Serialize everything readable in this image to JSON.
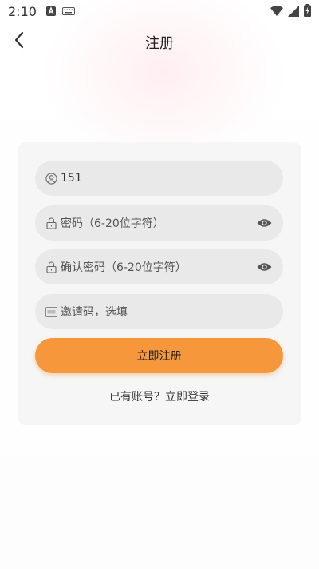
{
  "status_bar": {
    "time": "2:10",
    "icons": [
      "a-app-icon",
      "keyboard-icon",
      "wifi-icon",
      "signal-icon",
      "battery-charging-icon"
    ]
  },
  "header": {
    "title": "注册",
    "back_icon": "chevron-left-icon"
  },
  "form": {
    "phone": {
      "value": "151",
      "icon": "user-circle-icon"
    },
    "password": {
      "placeholder": "密码（6-20位字符）",
      "icon": "lock-icon",
      "toggle_icon": "eye-icon"
    },
    "confirm_password": {
      "placeholder": "确认密码（6-20位字符）",
      "icon": "lock-icon",
      "toggle_icon": "eye-icon"
    },
    "invite_code": {
      "placeholder": "邀请码，选填",
      "icon": "abc-keyboard-icon"
    },
    "submit_label": "立即注册",
    "login_prompt": "已有账号？",
    "login_link": "立即登录"
  },
  "colors": {
    "accent": "#f5973a",
    "field_bg": "#e9e9e9",
    "card_bg": "#f6f6f6"
  }
}
